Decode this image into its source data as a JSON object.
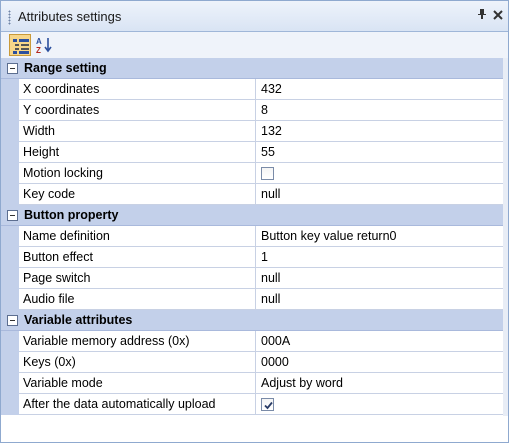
{
  "window": {
    "title": "Attributes settings",
    "pin_glyph": "⊥",
    "close_glyph": "✕"
  },
  "toolbar": {
    "categorized_icon": "categorized-icon",
    "alphabetical_icon": "alphabetical-icon"
  },
  "categories": [
    {
      "label": "Range setting",
      "rows": [
        {
          "name": "X coordinates",
          "value": "432",
          "kind": "text"
        },
        {
          "name": "Y coordinates",
          "value": "8",
          "kind": "text"
        },
        {
          "name": "Width",
          "value": "132",
          "kind": "text"
        },
        {
          "name": "Height",
          "value": "55",
          "kind": "text"
        },
        {
          "name": "Motion locking",
          "checked": false,
          "kind": "checkbox"
        },
        {
          "name": "Key code",
          "value": "null",
          "kind": "text"
        }
      ]
    },
    {
      "label": "Button property",
      "rows": [
        {
          "name": "Name definition",
          "value": "Button key value return0",
          "kind": "text"
        },
        {
          "name": "Button effect",
          "value": "1",
          "kind": "text"
        },
        {
          "name": "Page switch",
          "value": "null",
          "kind": "text"
        },
        {
          "name": "Audio file",
          "value": "null",
          "kind": "text"
        }
      ]
    },
    {
      "label": "Variable attributes",
      "rows": [
        {
          "name": "Variable memory address (0x)",
          "value": "000A",
          "kind": "text"
        },
        {
          "name": "Keys (0x)",
          "value": "0000",
          "kind": "text"
        },
        {
          "name": "Variable mode",
          "value": "Adjust by word",
          "kind": "text"
        },
        {
          "name": "After the data automatically upload",
          "checked": true,
          "kind": "checkbox"
        }
      ]
    }
  ]
}
